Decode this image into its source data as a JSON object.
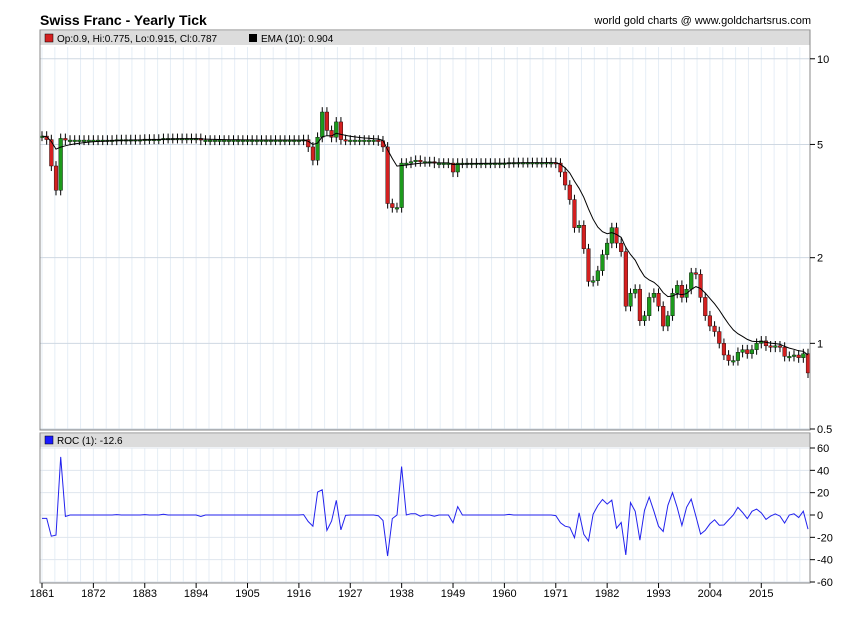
{
  "header": {
    "title": "Swiss Franc - Yearly Tick",
    "credit": "world gold charts @ www.goldchartsrus.com"
  },
  "legend": {
    "price_label": "Op:0.9, Hi:0.775, Lo:0.915, Cl:0.787",
    "ema_label": "EMA (10): 0.904",
    "roc_label": "ROC (1): -12.6",
    "price_swatch": "#d42020",
    "ema_swatch": "#000000",
    "roc_swatch": "#1a1aff"
  },
  "colors": {
    "up": "#1c9a1c",
    "down": "#d42020",
    "ema": "#000000",
    "roc": "#2222ee",
    "grid": "#e6eef6",
    "legend_bg": "#dcdcdc"
  },
  "chart_data": [
    {
      "type": "candlestick",
      "title": "Swiss Franc - Yearly Tick",
      "x_tick_labels": [
        "1861",
        "1872",
        "1883",
        "1894",
        "1905",
        "1916",
        "1927",
        "1938",
        "1949",
        "1960",
        "1971",
        "1982",
        "1993",
        "2004",
        "2015"
      ],
      "y_scale": "log",
      "y_tick_labels": [
        "10",
        "5",
        "2",
        "1",
        "0.5"
      ],
      "ylim": [
        0.5,
        11
      ],
      "years": [
        1861,
        1862,
        1863,
        1864,
        1865,
        1866,
        1867,
        1868,
        1869,
        1870,
        1871,
        1872,
        1873,
        1874,
        1875,
        1876,
        1877,
        1878,
        1879,
        1880,
        1881,
        1882,
        1883,
        1884,
        1885,
        1886,
        1887,
        1888,
        1889,
        1890,
        1891,
        1892,
        1893,
        1894,
        1895,
        1896,
        1897,
        1898,
        1899,
        1900,
        1901,
        1902,
        1903,
        1904,
        1905,
        1906,
        1907,
        1908,
        1909,
        1910,
        1911,
        1912,
        1913,
        1914,
        1915,
        1916,
        1917,
        1918,
        1919,
        1920,
        1921,
        1922,
        1923,
        1924,
        1925,
        1926,
        1927,
        1928,
        1929,
        1930,
        1931,
        1932,
        1933,
        1934,
        1935,
        1936,
        1937,
        1938,
        1939,
        1940,
        1941,
        1942,
        1943,
        1944,
        1945,
        1946,
        1947,
        1948,
        1949,
        1950,
        1951,
        1952,
        1953,
        1954,
        1955,
        1956,
        1957,
        1958,
        1959,
        1960,
        1961,
        1962,
        1963,
        1964,
        1965,
        1966,
        1967,
        1968,
        1969,
        1970,
        1971,
        1972,
        1973,
        1974,
        1975,
        1976,
        1977,
        1978,
        1979,
        1980,
        1981,
        1982,
        1983,
        1984,
        1985,
        1986,
        1987,
        1988,
        1989,
        1990,
        1991,
        1992,
        1993,
        1994,
        1995,
        1996,
        1997,
        1998,
        1999,
        2000,
        2001,
        2002,
        2003,
        2004,
        2005,
        2006,
        2007,
        2008,
        2009,
        2010,
        2011,
        2012,
        2013,
        2014,
        2015,
        2016,
        2017,
        2018,
        2019,
        2020,
        2021,
        2022,
        2023,
        2024,
        2025
      ],
      "close": [
        5.35,
        5.2,
        4.2,
        3.45,
        5.25,
        5.18,
        5.18,
        5.18,
        5.18,
        5.18,
        5.18,
        5.18,
        5.18,
        5.18,
        5.18,
        5.18,
        5.2,
        5.2,
        5.2,
        5.2,
        5.2,
        5.2,
        5.22,
        5.22,
        5.22,
        5.22,
        5.25,
        5.25,
        5.25,
        5.25,
        5.25,
        5.25,
        5.25,
        5.25,
        5.18,
        5.18,
        5.18,
        5.18,
        5.18,
        5.18,
        5.18,
        5.18,
        5.18,
        5.18,
        5.18,
        5.18,
        5.18,
        5.18,
        5.18,
        5.18,
        5.18,
        5.18,
        5.18,
        5.18,
        5.18,
        5.18,
        5.2,
        4.9,
        4.4,
        5.3,
        6.5,
        5.6,
        5.3,
        6.0,
        5.2,
        5.18,
        5.18,
        5.18,
        5.18,
        5.18,
        5.18,
        5.18,
        5.15,
        4.9,
        3.1,
        3.0,
        3.0,
        4.3,
        4.3,
        4.35,
        4.4,
        4.35,
        4.35,
        4.35,
        4.3,
        4.3,
        4.3,
        4.3,
        4.0,
        4.3,
        4.3,
        4.3,
        4.3,
        4.3,
        4.3,
        4.3,
        4.3,
        4.3,
        4.3,
        4.3,
        4.32,
        4.32,
        4.32,
        4.32,
        4.32,
        4.32,
        4.32,
        4.32,
        4.32,
        4.32,
        4.3,
        4.0,
        3.6,
        3.2,
        2.55,
        2.6,
        2.15,
        1.65,
        1.66,
        1.8,
        2.05,
        2.25,
        2.55,
        2.25,
        2.1,
        1.35,
        1.5,
        1.55,
        1.2,
        1.25,
        1.45,
        1.5,
        1.35,
        1.15,
        1.25,
        1.5,
        1.6,
        1.45,
        1.55,
        1.77,
        1.75,
        1.45,
        1.25,
        1.15,
        1.1,
        1.0,
        0.91,
        0.87,
        0.87,
        0.93,
        0.95,
        0.92,
        0.95,
        1.0,
        1.02,
        0.98,
        0.97,
        0.98,
        0.97,
        0.9,
        0.9,
        0.91,
        0.89,
        0.92,
        0.787
      ],
      "ema_period": 10,
      "ema_current": 0.904
    },
    {
      "type": "line",
      "series": [
        {
          "name": "ROC (1)"
        }
      ],
      "y_tick_labels": [
        "60",
        "40",
        "20",
        "0",
        "-20",
        "-40",
        "-60"
      ],
      "ylim": [
        -60,
        60
      ],
      "x": "years (shared with price panel)",
      "values": [
        -3,
        -3,
        -19,
        -18,
        52,
        -1.3,
        0,
        0,
        0,
        0,
        0,
        0,
        0,
        0,
        0,
        0,
        0.4,
        0,
        0,
        0,
        0,
        0,
        0.4,
        0,
        0,
        0,
        0.6,
        0,
        0,
        0,
        0,
        0,
        0,
        0,
        -1.3,
        0,
        0,
        0,
        0,
        0,
        0,
        0,
        0,
        0,
        0,
        0,
        0,
        0,
        0,
        0,
        0,
        0,
        0,
        0,
        0,
        0,
        0.4,
        -5.8,
        -10,
        20.5,
        22.6,
        -13.8,
        -5.4,
        13.2,
        -13.3,
        -0.4,
        0,
        0,
        0,
        0,
        0,
        0,
        -0.6,
        -4.9,
        -36.7,
        -3.2,
        0,
        43.3,
        0,
        1.2,
        1.1,
        -1.1,
        0,
        0,
        -1.1,
        0,
        0,
        0,
        -7,
        7.5,
        0,
        0,
        0,
        0,
        0,
        0,
        0,
        0,
        0,
        0,
        0.5,
        0,
        0,
        0,
        0,
        0,
        0,
        0,
        0,
        0,
        -0.5,
        -7,
        -10,
        -11,
        -20.3,
        2,
        -17.3,
        -23.3,
        0.6,
        8.4,
        13.9,
        9.8,
        13.3,
        -11.8,
        -6.7,
        -35.7,
        11.1,
        3.3,
        -22.6,
        4.2,
        16,
        3.4,
        -10,
        -14.8,
        8.7,
        20,
        6.7,
        -9.4,
        6.9,
        14.2,
        -1.1,
        -17.1,
        -13.8,
        -8,
        -4.3,
        -9.1,
        -9,
        -4.4,
        0,
        6.9,
        2.2,
        -3.2,
        3.3,
        5.3,
        2,
        -3.9,
        -1,
        1,
        -1,
        -7.2,
        0,
        1.1,
        -2.2,
        3.4,
        -12.6
      ]
    }
  ]
}
